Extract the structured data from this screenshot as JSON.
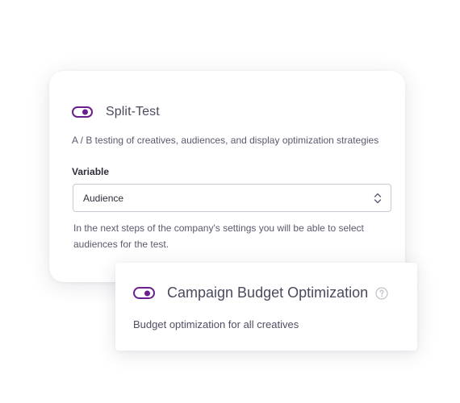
{
  "split_test": {
    "toggle_on": true,
    "title": "Split-Test",
    "description": "A / B testing of creatives, audiences, and display optimization strategies",
    "variable_label": "Variable",
    "variable_select": {
      "value": "Audience"
    },
    "helper_text": "In the next steps of the company's settings you will be able to select audiences for the test."
  },
  "campaign_budget_optimization": {
    "toggle_on": true,
    "title": "Campaign Budget Optimization",
    "description": "Budget optimization for all creatives"
  },
  "icons": {
    "help": "question-circle-icon",
    "select": "chevron-up-down-icon"
  },
  "colors": {
    "accent": "#6b1f8f",
    "text_primary": "#4a4a5e",
    "text_dark": "#2e2e3a",
    "border": "#c9c9d3"
  }
}
